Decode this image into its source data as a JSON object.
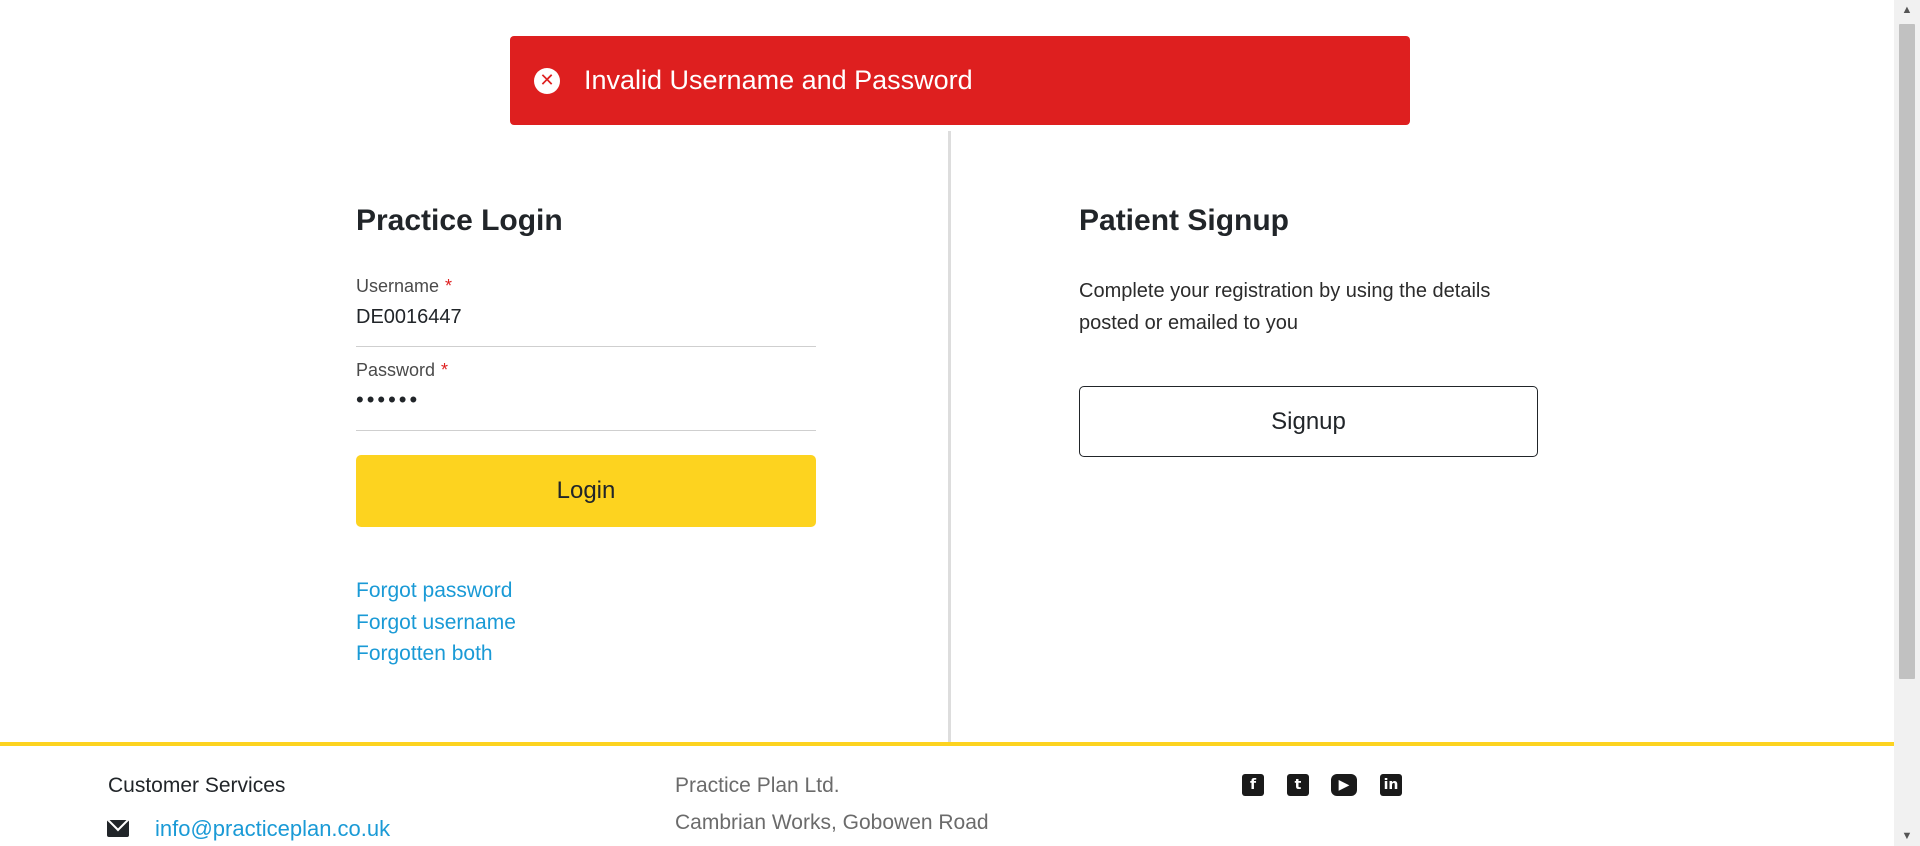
{
  "alert": {
    "icon": "close-circle-icon",
    "message": "Invalid Username and Password",
    "color": "#de1f1f"
  },
  "login": {
    "title": "Practice Login",
    "username_label": "Username",
    "username_value": "DE0016447",
    "password_label": "Password",
    "password_value": "••••••",
    "required_mark": "*",
    "login_button": "Login",
    "links": [
      "Forgot password",
      "Forgot username",
      "Forgotten both"
    ]
  },
  "signup": {
    "title": "Patient Signup",
    "description": "Complete your registration by using the details posted or emailed to you",
    "signup_button": "Signup"
  },
  "footer": {
    "customer_services_title": "Customer Services",
    "email_icon": "envelope-icon",
    "email": "info@practiceplan.co.uk",
    "company": "Practice Plan Ltd.",
    "address_line": "Cambrian Works, Gobowen Road",
    "social_icons": [
      "facebook-icon",
      "twitter-icon",
      "youtube-icon",
      "linkedin-icon"
    ],
    "accent_color": "#fdd31f"
  },
  "colors": {
    "accent": "#fdd31f",
    "link": "#1a9ad6",
    "error": "#de1f1f"
  }
}
